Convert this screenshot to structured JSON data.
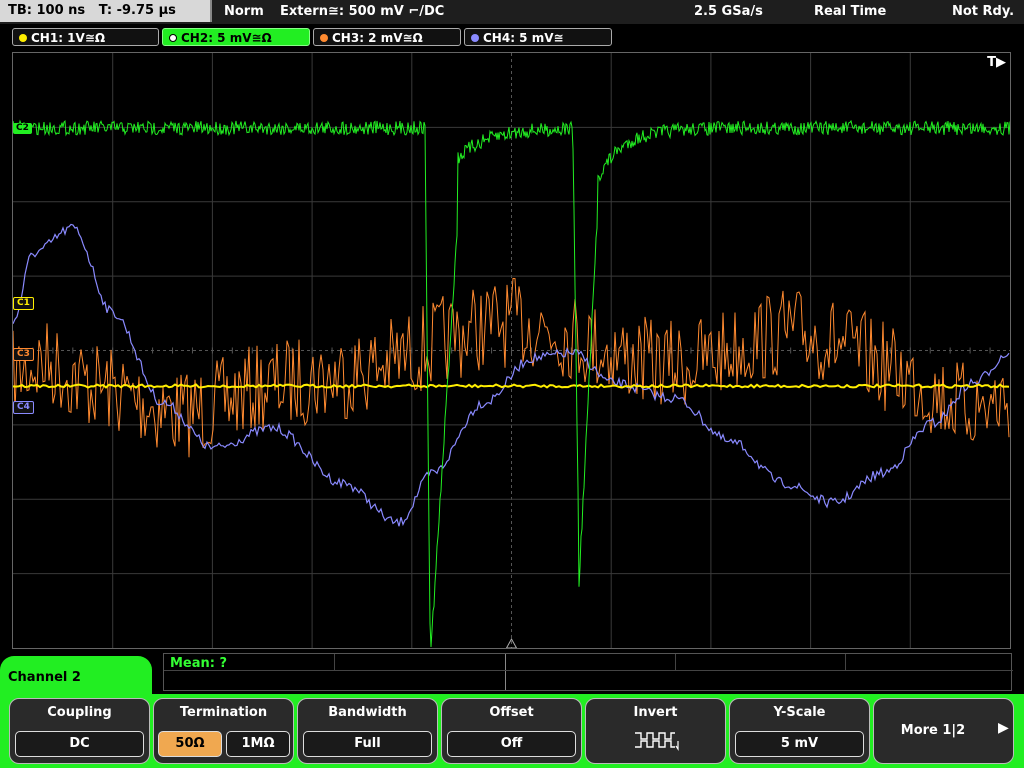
{
  "status_bar": {
    "timebase": "TB: 100 ns",
    "trigger_time": "T: -9.75 µs",
    "mode": "Norm",
    "trigger": "Extern≅: 500 mV ⌐/DC",
    "sample_rate": "2.5 GSa/s",
    "acq_mode": "Real Time",
    "state": "Not Rdy."
  },
  "channels": [
    {
      "label": "CH1: 1V≅Ω",
      "color": "#ffee00",
      "active": false
    },
    {
      "label": "CH2: 5 mV≅Ω",
      "color": "#22ee22",
      "active": true
    },
    {
      "label": "CH3: 2 mV≅Ω",
      "color": "#ff8a30",
      "active": false
    },
    {
      "label": "CH4: 5 mV≅",
      "color": "#8a8aff",
      "active": false
    }
  ],
  "screen": {
    "trigger_marker": "T▶",
    "markers": {
      "c1": "C1",
      "c2": "C2",
      "c3": "C3",
      "c4": "C4"
    }
  },
  "measurement": {
    "mean": "Mean: ?"
  },
  "menu": {
    "title": "Channel 2",
    "coupling": {
      "label": "Coupling",
      "value": "DC"
    },
    "termination": {
      "label": "Termination",
      "opt1": "50Ω",
      "opt2": "1MΩ"
    },
    "bandwidth": {
      "label": "Bandwidth",
      "value": "Full"
    },
    "offset": {
      "label": "Offset",
      "value": "Off"
    },
    "invert": {
      "label": "Invert"
    },
    "yscale": {
      "label": "Y-Scale",
      "value": "5 mV"
    },
    "more": {
      "label": "More 1|2"
    }
  }
}
